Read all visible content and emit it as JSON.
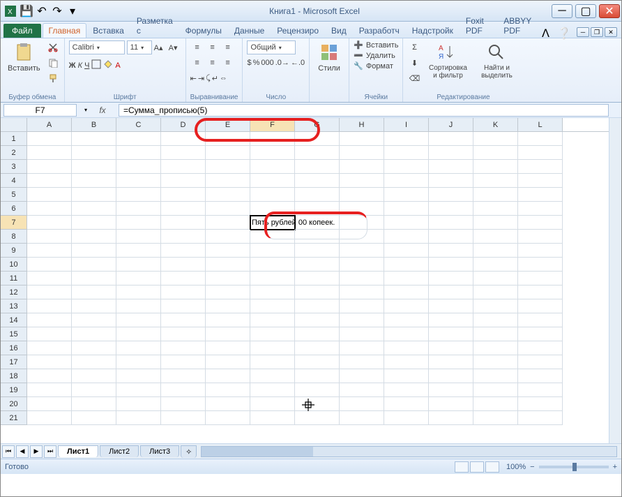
{
  "window": {
    "title": "Книга1 - Microsoft Excel",
    "qat_save": "💾",
    "qat_undo": "↶",
    "qat_redo": "↷"
  },
  "tabs": {
    "file": "Файл",
    "items": [
      {
        "label": "Главная",
        "active": true
      },
      {
        "label": "Вставка"
      },
      {
        "label": "Разметка с"
      },
      {
        "label": "Формулы"
      },
      {
        "label": "Данные"
      },
      {
        "label": "Рецензиро"
      },
      {
        "label": "Вид"
      },
      {
        "label": "Разработч"
      },
      {
        "label": "Надстройк"
      },
      {
        "label": "Foxit PDF"
      },
      {
        "label": "ABBYY PDF"
      }
    ]
  },
  "ribbon": {
    "clipboard": {
      "paste": "Вставить",
      "label": "Буфер обмена"
    },
    "font": {
      "name": "Calibri",
      "size": "11",
      "label": "Шрифт"
    },
    "alignment": {
      "label": "Выравнивание"
    },
    "number": {
      "format": "Общий",
      "label": "Число"
    },
    "styles": {
      "btn": "Стили"
    },
    "cells": {
      "insert": "Вставить",
      "delete": "Удалить",
      "format": "Формат",
      "label": "Ячейки"
    },
    "editing": {
      "sort": "Сортировка и фильтр",
      "find": "Найти и выделить",
      "label": "Редактирование"
    }
  },
  "namebox": {
    "ref": "F7"
  },
  "formula": {
    "value": "=Сумма_прописью(5)"
  },
  "grid": {
    "columns": [
      "A",
      "B",
      "C",
      "D",
      "E",
      "F",
      "G",
      "H",
      "I",
      "J",
      "K",
      "L"
    ],
    "rows": [
      1,
      2,
      3,
      4,
      5,
      6,
      7,
      8,
      9,
      10,
      11,
      12,
      13,
      14,
      15,
      16,
      17,
      18,
      19,
      20,
      21
    ],
    "active_col": "F",
    "active_row": 7,
    "cell_value": "Пять рублей 00 копеек."
  },
  "sheets": {
    "items": [
      {
        "name": "Лист1",
        "active": true
      },
      {
        "name": "Лист2"
      },
      {
        "name": "Лист3"
      }
    ]
  },
  "status": {
    "state": "Готово",
    "zoom": "100%",
    "minus": "−",
    "plus": "+"
  }
}
